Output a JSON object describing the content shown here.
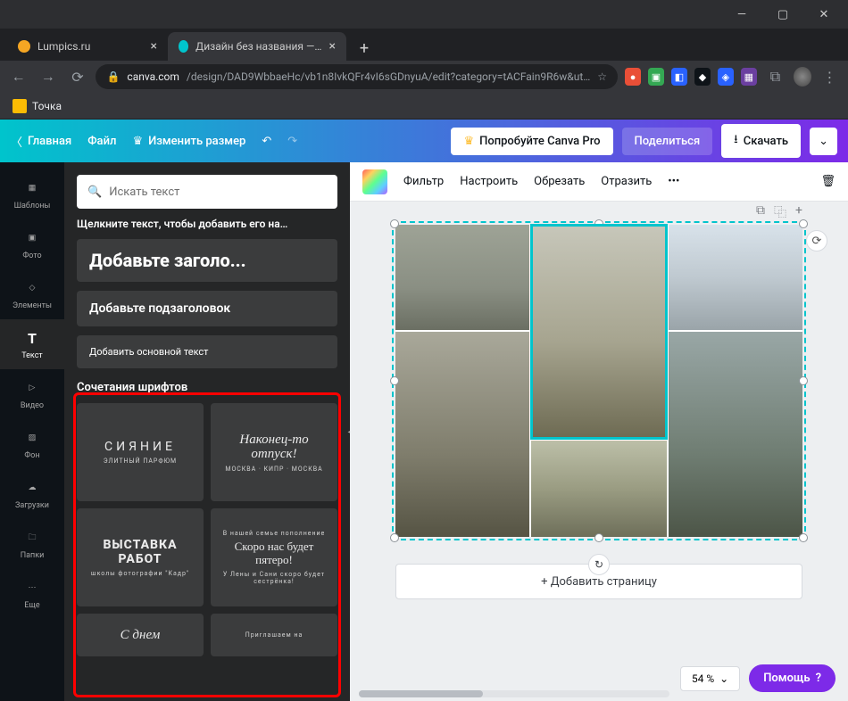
{
  "window": {
    "title": ""
  },
  "tabs": [
    {
      "label": "Lumpics.ru",
      "favicon": "#f5a623"
    },
    {
      "label": "Дизайн без названия — Фотокс",
      "favicon": "#00c4cc"
    }
  ],
  "url": {
    "lock": "🔒",
    "domain": "canva.com",
    "path": "/design/DAD9WbbaeHc/vb1n8IvkQFr4vI6sGDnyuA/edit?category=tACFain9R6w&ut…"
  },
  "bookmarks": {
    "item1": "Точка"
  },
  "toolbar": {
    "home": "Главная",
    "file": "Файл",
    "resize": "Изменить размер",
    "try_pro": "Попробуйте Canva Pro",
    "share": "Поделиться",
    "download": "Скачать"
  },
  "rail": {
    "templates": "Шаблоны",
    "photos": "Фото",
    "elements": "Элементы",
    "text": "Текст",
    "video": "Видео",
    "background": "Фон",
    "uploads": "Загрузки",
    "folders": "Папки",
    "more": "Еще"
  },
  "panel": {
    "search_placeholder": "Искать текст",
    "hint": "Щелкните текст, чтобы добавить его на…",
    "add_heading": "Добавьте заголо...",
    "add_subheading": "Добавьте подзаголовок",
    "add_body": "Добавить основной текст",
    "combos_title": "Сочетания шрифтов",
    "cards": {
      "c1_big": "СИЯНИЕ",
      "c1_small": "ЭЛИТНЫЙ ПАРФЮМ",
      "c2_big": "Наконец-то отпуск!",
      "c2_small": "МОСКВА · КИПР · МОСКВА",
      "c3_big": "ВЫСТАВКА РАБОТ",
      "c3_small": "школы фотографии \"Кадр\"",
      "c4_top": "В нашей семье пополнение",
      "c4_big": "Скоро нас будет пятеро!",
      "c4_small": "У Лены и Сани скоро будет сестрёнка!",
      "c5_big": "С днем",
      "c6_small": "Приглашаем на"
    }
  },
  "ctx": {
    "filter": "Фильтр",
    "adjust": "Настроить",
    "crop": "Обрезать",
    "flip": "Отразить",
    "more": "•••"
  },
  "canvas": {
    "add_page": "+ Добавить страницу"
  },
  "footer": {
    "zoom": "54 %",
    "help": "Помощь"
  }
}
